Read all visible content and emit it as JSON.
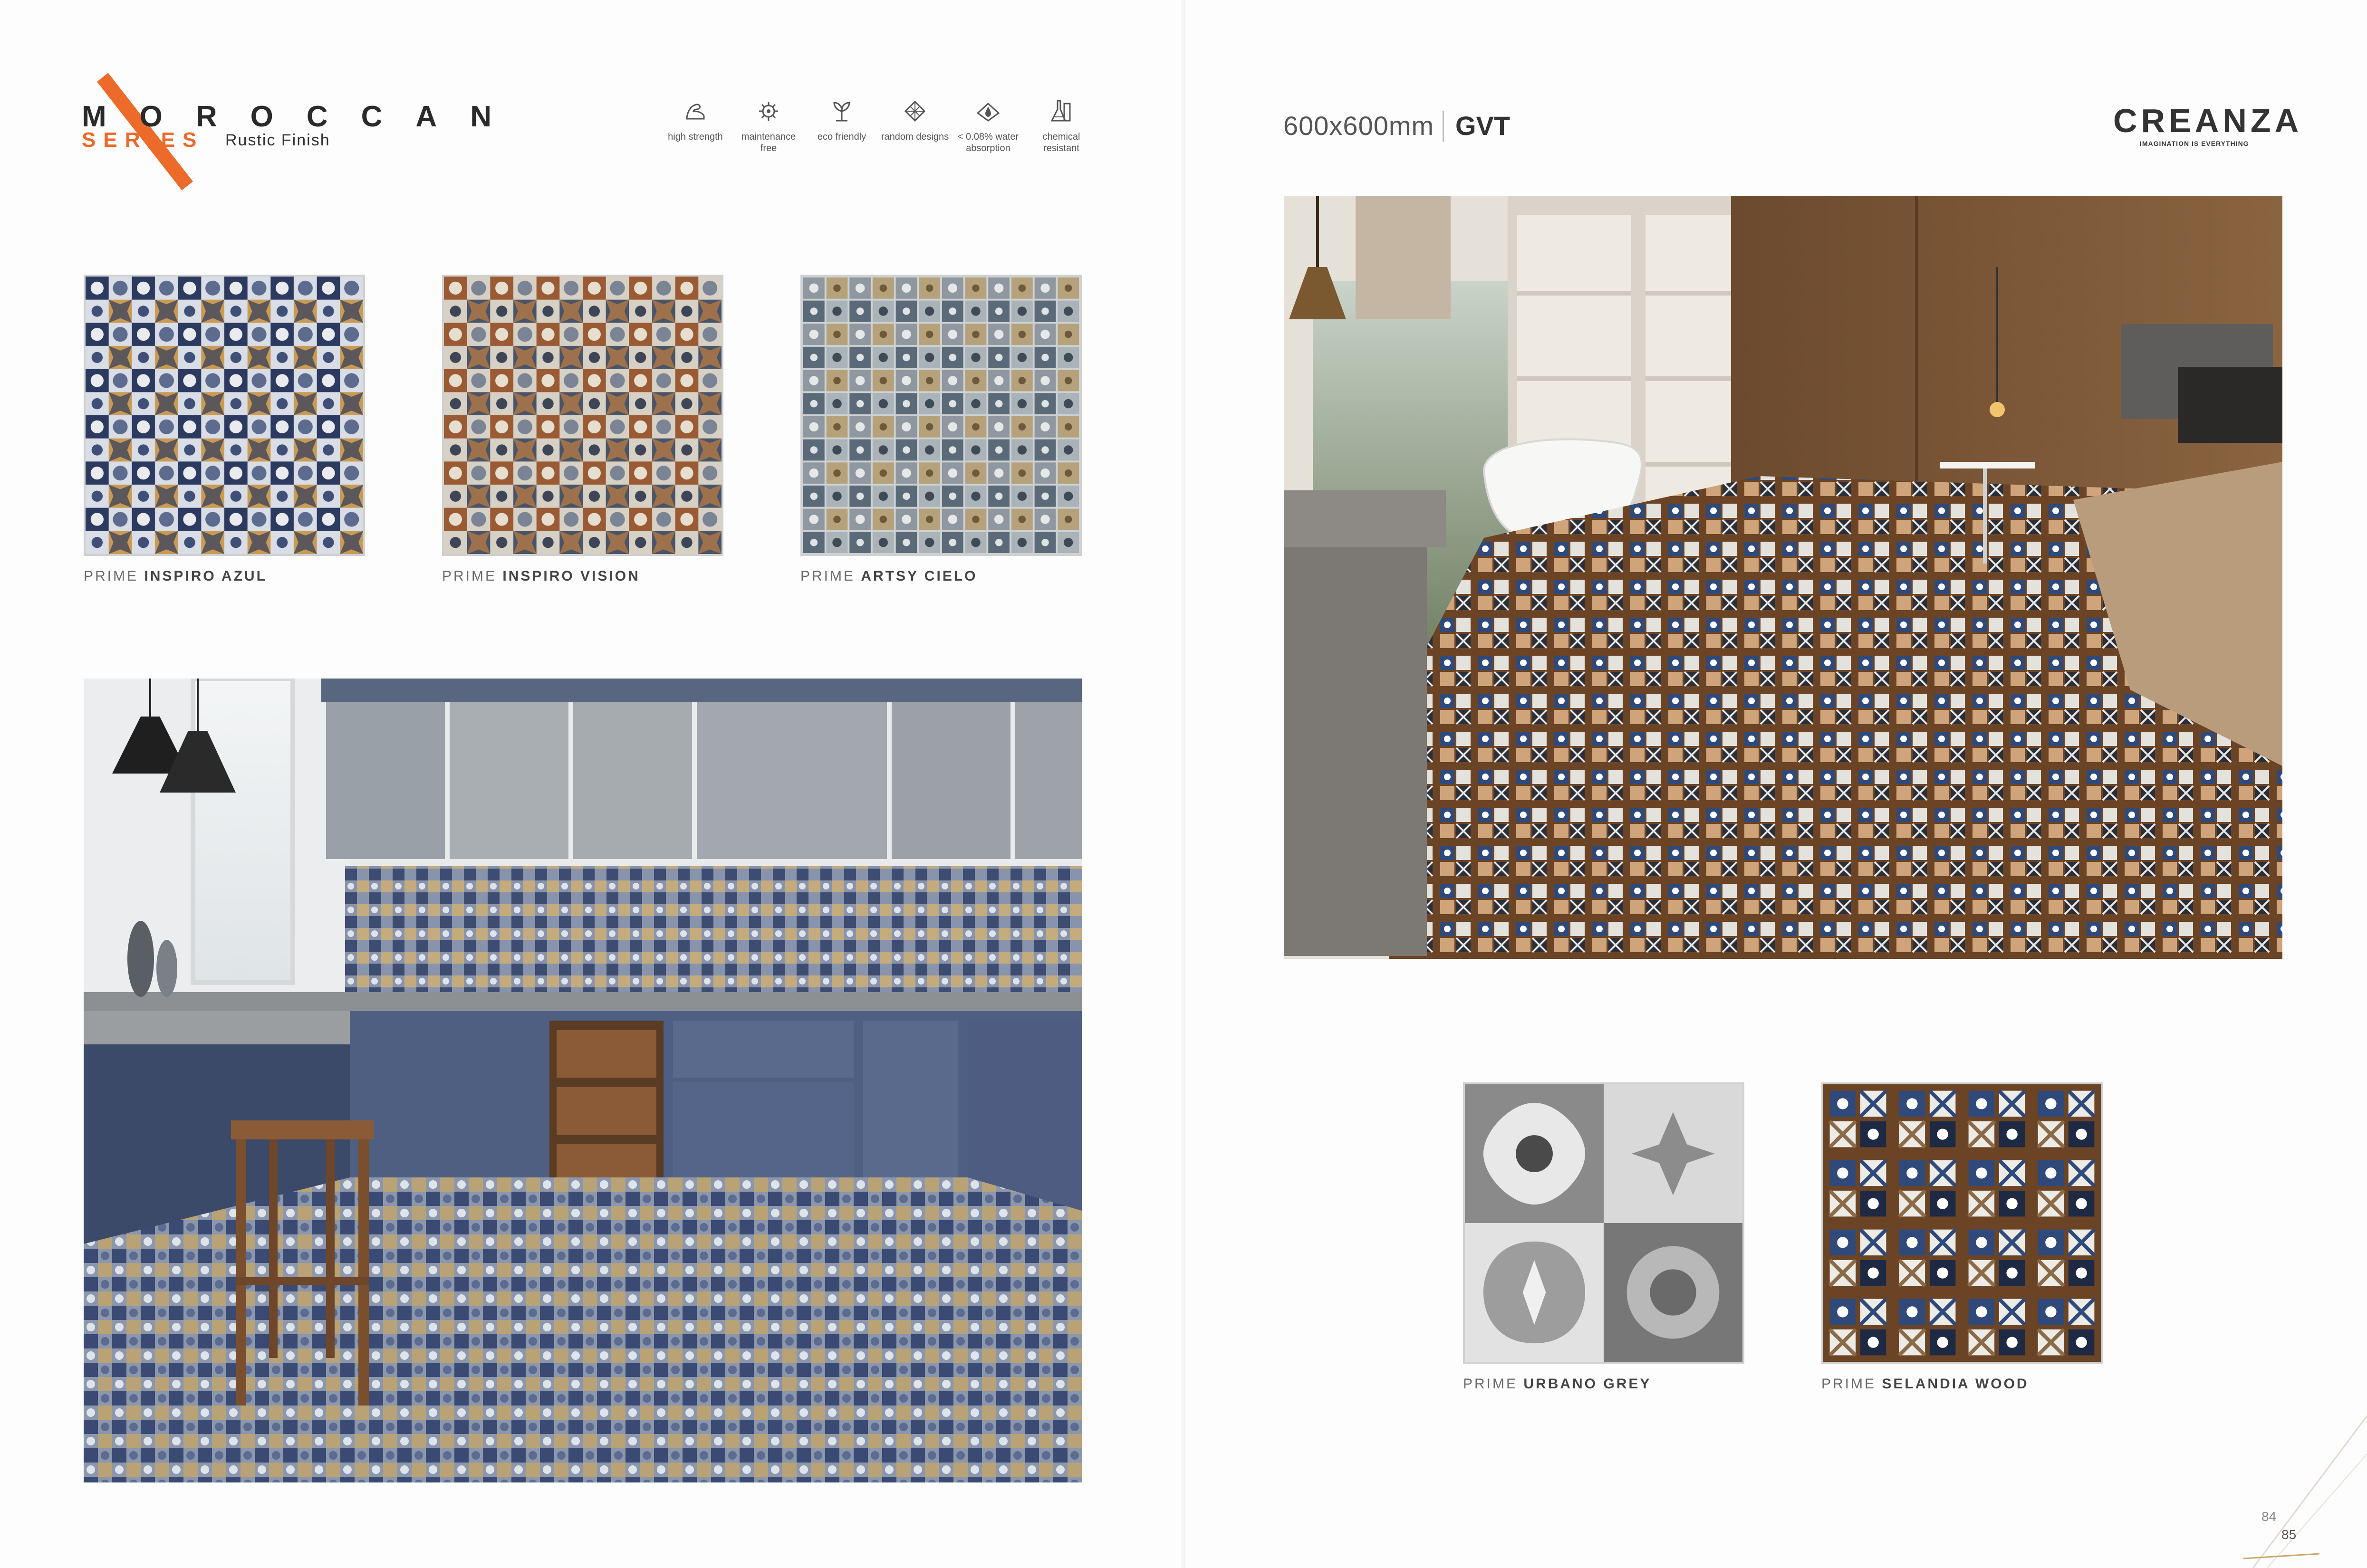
{
  "header": {
    "title": "MOROCCAN",
    "series": "SERIES",
    "finish": "Rustic Finish"
  },
  "features": [
    {
      "icon": "arm-strength-icon",
      "label": "high strength"
    },
    {
      "icon": "maintenance-icon",
      "label": "maintenance free"
    },
    {
      "icon": "leaf-icon",
      "label": "eco friendly"
    },
    {
      "icon": "diamond-pattern-icon",
      "label": "random designs"
    },
    {
      "icon": "water-drop-icon",
      "label": "< 0.08% water absorption"
    },
    {
      "icon": "flask-icon",
      "label": "chemical resistant"
    }
  ],
  "left_tiles": [
    {
      "prefix": "PRIME",
      "name": "INSPIRO AZUL"
    },
    {
      "prefix": "PRIME",
      "name": "INSPIRO VISION"
    },
    {
      "prefix": "PRIME",
      "name": "ARTSY CIELO"
    }
  ],
  "right_header": {
    "size": "600x600mm",
    "type": "GVT",
    "logo": "CREANZA",
    "tagline": "IMAGINATION IS EVERYTHING"
  },
  "right_tiles": [
    {
      "prefix": "PRIME",
      "name": "URBANO GREY"
    },
    {
      "prefix": "PRIME",
      "name": "SELANDIA WOOD"
    }
  ],
  "pages": {
    "left": "84",
    "right": "85"
  },
  "colors": {
    "accent": "#ec6a2a",
    "text": "#333333",
    "navy": "#2c3a60",
    "wood": "#6b4426"
  }
}
